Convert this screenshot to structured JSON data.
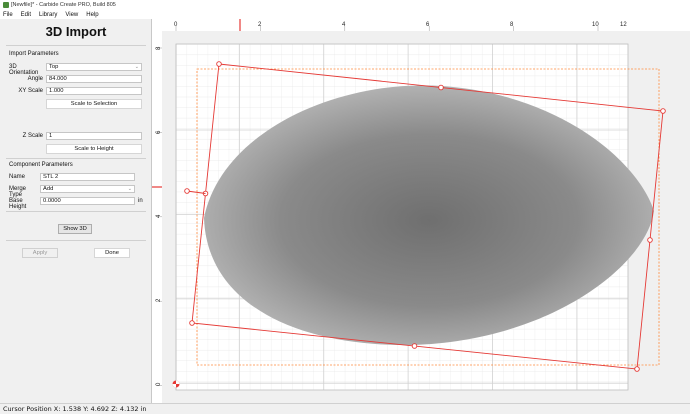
{
  "window": {
    "title": "[Newfile]* - Carbide Create PRO, Build 805"
  },
  "menu": [
    "File",
    "Edit",
    "Library",
    "View",
    "Help"
  ],
  "panel": {
    "title": "3D Import",
    "import_section": "Import Parameters",
    "orientation_label": "3D Orientation",
    "orientation_value": "Top",
    "angle_label": "Angle",
    "angle_value": "84.000",
    "xy_scale_label": "XY Scale",
    "xy_scale_value": "1.000",
    "scale_to_selection": "Scale to Selection",
    "z_scale_label": "Z Scale",
    "z_scale_value": "1",
    "scale_to_height": "Scale to Height",
    "component_section": "Component Parameters",
    "name_label": "Name",
    "name_value": "STL 2",
    "merge_label": "Merge Type",
    "merge_value": "Add",
    "base_height_label": "Base Height",
    "base_height_value": "0.0000",
    "base_height_unit": "in",
    "show_3d": "Show 3D",
    "apply": "Apply",
    "done": "Done"
  },
  "ruler": {
    "x_ticks": [
      "0",
      "2",
      "4",
      "6",
      "8",
      "10",
      "12"
    ],
    "y_ticks": [
      "8",
      "6",
      "4",
      "2",
      "0"
    ]
  },
  "colors": {
    "selection": "#e53935",
    "stock_border": "#ff8a3d",
    "grid": "#dcdcdc",
    "model_dark": "#6f6f6f",
    "model_light": "#b8b8b8"
  },
  "status": {
    "text": "Cursor Position X: 1.538 Y: 4.692 Z: 4.132 in"
  }
}
